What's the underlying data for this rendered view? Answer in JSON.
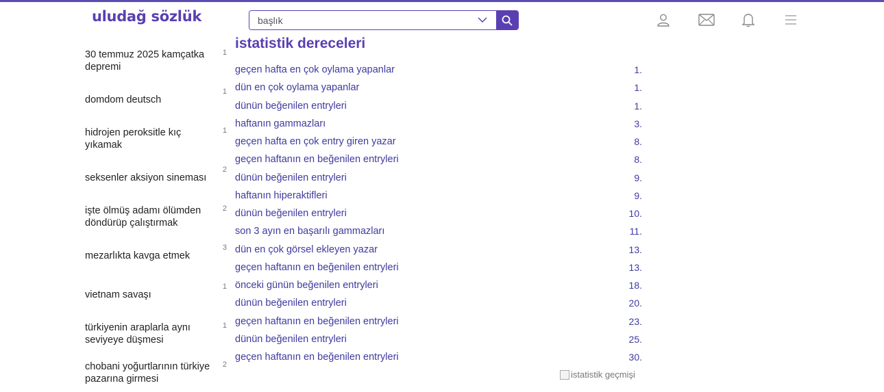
{
  "header": {
    "logo": "uludağ sözlük",
    "search_placeholder": "başlık",
    "accent_color": "#5a3fb2",
    "icons": [
      "user-icon",
      "mail-icon",
      "bell-icon",
      "menu-icon"
    ]
  },
  "sidebar": {
    "items": [
      {
        "label": "30 temmuz 2025 kamçatka depremi",
        "count": "1"
      },
      {
        "label": "domdom deutsch",
        "count": "1"
      },
      {
        "label": "hidrojen peroksitle kıç yıkamak",
        "count": "1"
      },
      {
        "label": "seksenler aksiyon sineması",
        "count": "2"
      },
      {
        "label": "işte ölmüş adamı ölümden döndürüp çalıştırmak",
        "count": "2"
      },
      {
        "label": "mezarlıkta kavga etmek",
        "count": "3"
      },
      {
        "label": "vietnam savaşı",
        "count": "1"
      },
      {
        "label": "türkiyenin araplarla aynı seviyeye düşmesi",
        "count": "1"
      },
      {
        "label": "chobani yoğurtlarının türkiye pazarına girmesi",
        "count": "2"
      }
    ]
  },
  "main": {
    "title": "istatistik dereceleri",
    "stats": [
      {
        "label": "geçen hafta en çok oylama yapanlar",
        "rank": "1."
      },
      {
        "label": "dün en çok oylama yapanlar",
        "rank": "1."
      },
      {
        "label": "dünün beğenilen entryleri",
        "rank": "1."
      },
      {
        "label": "haftanın gammazları",
        "rank": "3."
      },
      {
        "label": "geçen hafta en çok entry giren yazar",
        "rank": "8."
      },
      {
        "label": "geçen haftanın en beğenilen entryleri",
        "rank": "8."
      },
      {
        "label": "dünün beğenilen entryleri",
        "rank": "9."
      },
      {
        "label": "haftanın hiperaktifleri",
        "rank": "9."
      },
      {
        "label": "dünün beğenilen entryleri",
        "rank": "10."
      },
      {
        "label": "son 3 ayın en başarılı gammazları",
        "rank": "11."
      },
      {
        "label": "dün en çok görsel ekleyen yazar",
        "rank": "13."
      },
      {
        "label": "geçen haftanın en beğenilen entryleri",
        "rank": "13."
      },
      {
        "label": "önceki günün beğenilen entryleri",
        "rank": "18."
      },
      {
        "label": "dünün beğenilen entryleri",
        "rank": "20."
      },
      {
        "label": "geçen haftanın en beğenilen entryleri",
        "rank": "23."
      },
      {
        "label": "dünün beğenilen entryleri",
        "rank": "25."
      },
      {
        "label": "geçen haftanın en beğenilen entryleri",
        "rank": "30."
      }
    ],
    "history_image_alt": "istatistik geçmişi"
  }
}
